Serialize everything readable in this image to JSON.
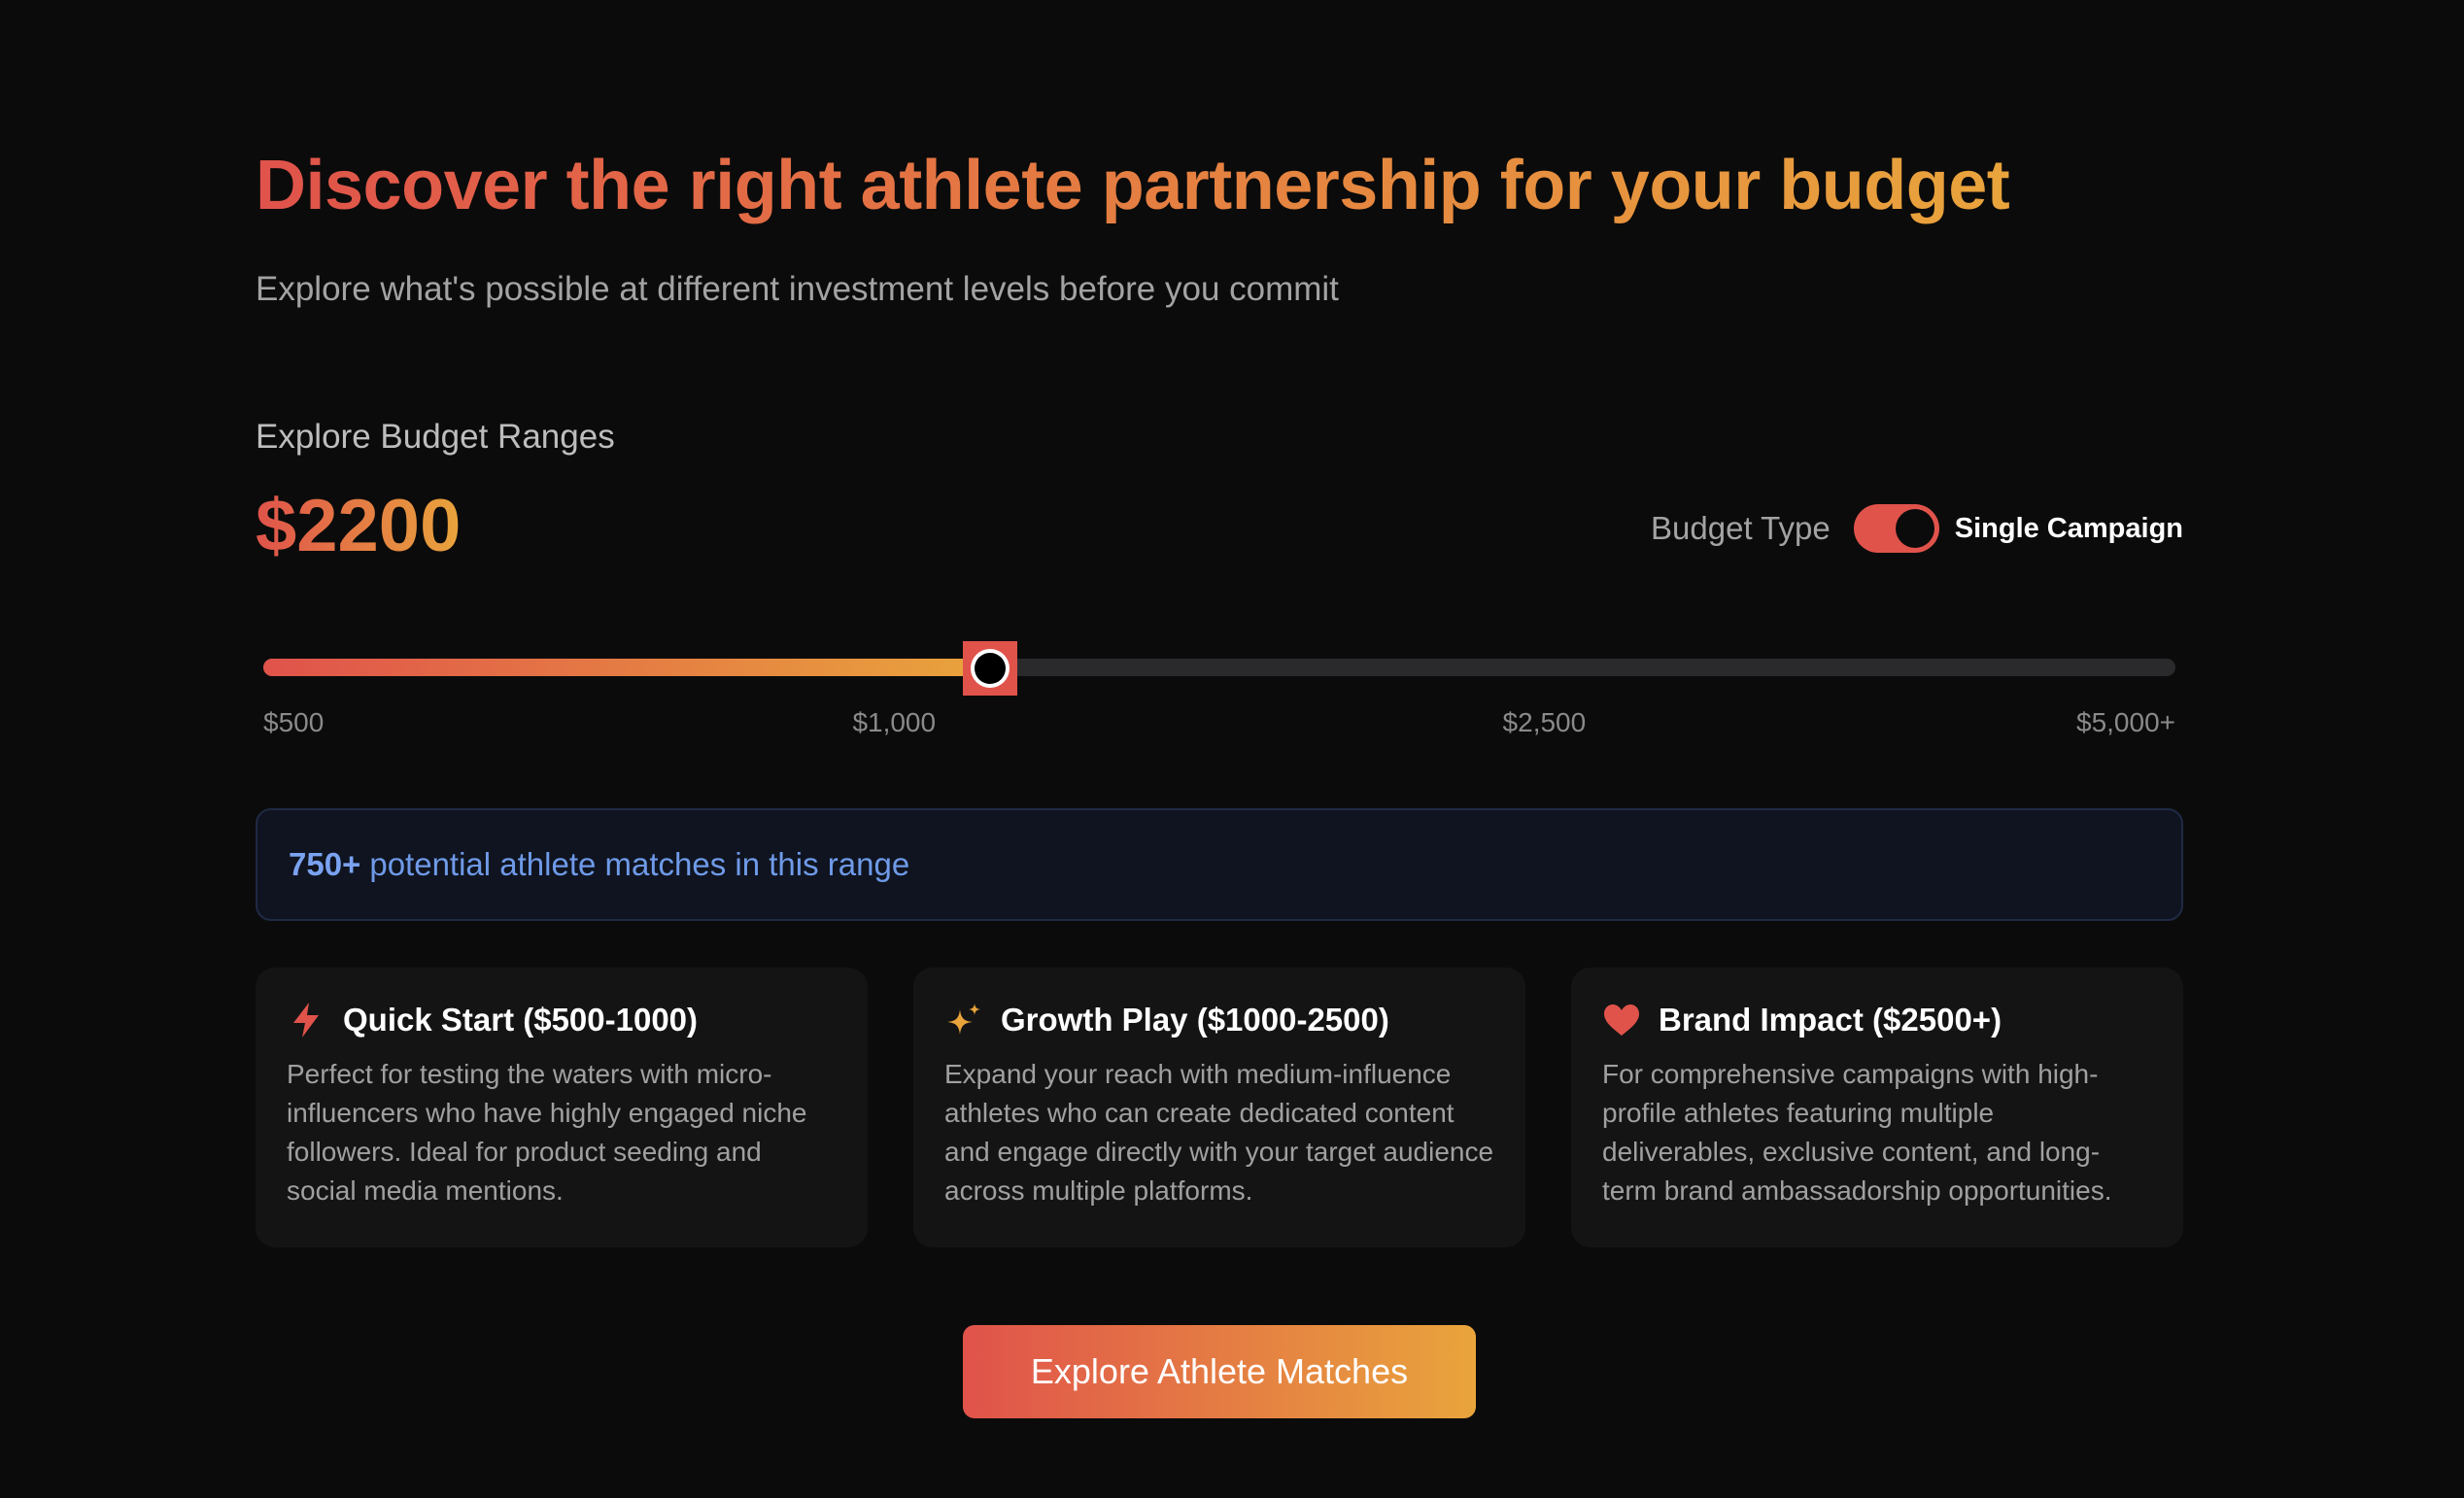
{
  "header": {
    "title": "Discover the right athlete partnership for your budget",
    "subtitle": "Explore what's possible at different investment levels before you commit"
  },
  "budget": {
    "section_label": "Explore Budget Ranges",
    "current_value": "$2200",
    "type_label": "Budget Type",
    "type_value": "Single Campaign",
    "toggle_on": true
  },
  "slider": {
    "fill_fraction": 0.38,
    "ticks": [
      {
        "label": "$500",
        "fraction": 0.0
      },
      {
        "label": "$1,000",
        "fraction": 0.33
      },
      {
        "label": "$2,500",
        "fraction": 0.67
      },
      {
        "label": "$5,000+",
        "fraction": 1.0
      }
    ]
  },
  "matches": {
    "count": "750+",
    "text": "potential athlete matches in this range"
  },
  "tiers": [
    {
      "icon": "lightning-icon",
      "title": "Quick Start ($500-1000)",
      "description": "Perfect for testing the waters with micro-influencers who have highly engaged niche followers. Ideal for product seeding and social media mentions."
    },
    {
      "icon": "sparkle-icon",
      "title": "Growth Play ($1000-2500)",
      "description": "Expand your reach with medium-influence athletes who can create dedicated content and engage directly with your target audience across multiple platforms."
    },
    {
      "icon": "heart-icon",
      "title": "Brand Impact ($2500+)",
      "description": "For comprehensive campaigns with high-profile athletes featuring multiple deliverables, exclusive content, and long-term brand ambassadorship opportunities."
    }
  ],
  "cta": {
    "label": "Explore Athlete Matches"
  },
  "colors": {
    "accent_start": "#e0534b",
    "accent_end": "#e9a43c",
    "background": "#0b0b0b",
    "info_text": "#6f9ae8"
  }
}
